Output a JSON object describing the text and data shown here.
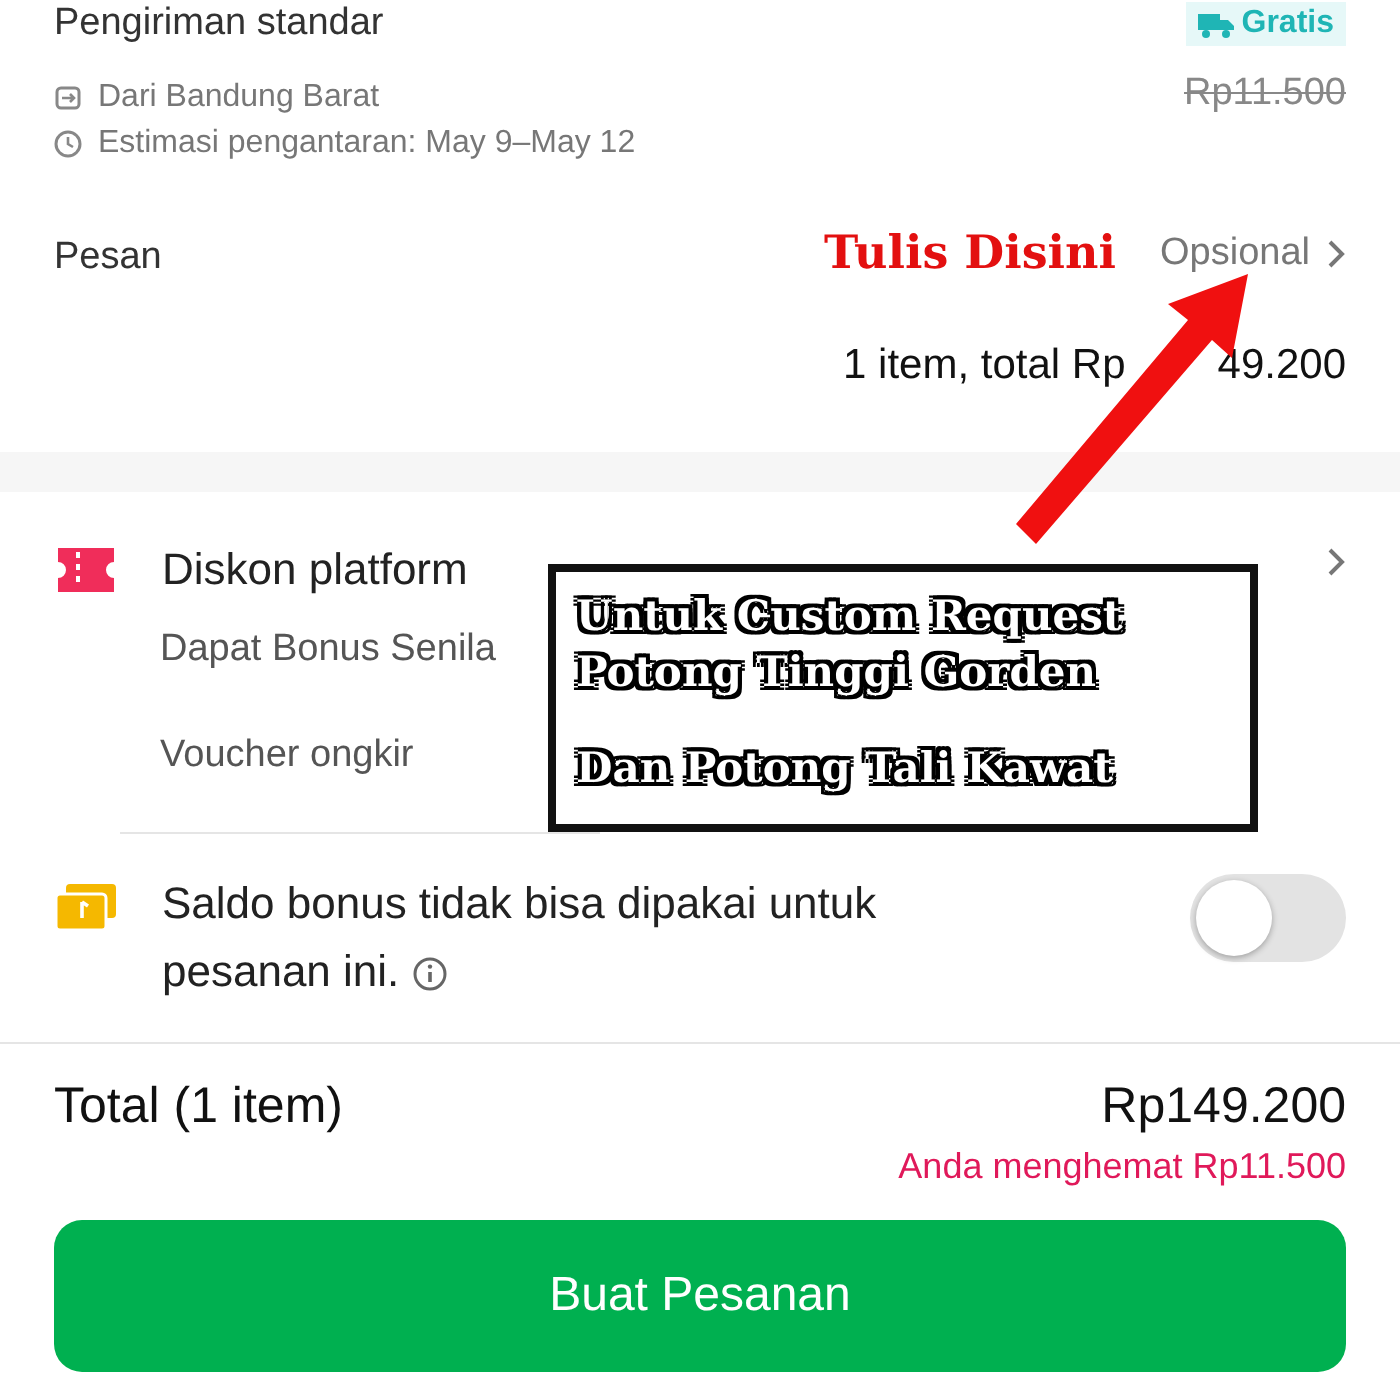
{
  "shipping": {
    "method": "Pengiriman standar",
    "badge": "Gratis",
    "origin": "Dari Bandung Barat",
    "estimate": "Estimasi pengantaran: May 9–May 12",
    "original_price": "Rp11.500"
  },
  "message": {
    "label": "Pesan",
    "placeholder": "Opsional"
  },
  "summary": {
    "parts": [
      "1 item, total Rp",
      "49.200"
    ]
  },
  "discounts": {
    "title": "Diskon platform",
    "rows": [
      "Dapat Bonus Senila",
      "Voucher ongkir"
    ]
  },
  "bonus": {
    "text": "Saldo bonus tidak bisa dipakai untuk pesanan ini.",
    "on": false
  },
  "total": {
    "label": "Total (1 item)",
    "amount": "Rp149.200",
    "savings": "Anda menghemat Rp11.500"
  },
  "button": "Buat Pesanan",
  "annotations": {
    "callout": "Tulis Disini",
    "note_paragraphs": [
      [
        "Untuk Custom Request",
        "Potong Tinggi Gorden"
      ],
      [
        "Dan Potong Tali Kawat"
      ]
    ]
  }
}
